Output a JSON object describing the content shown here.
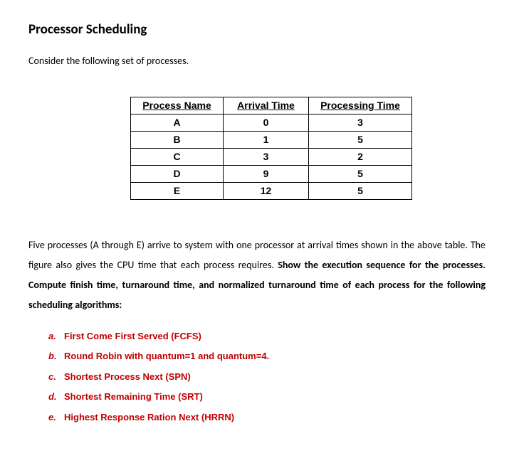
{
  "title": "Processor Scheduling",
  "intro": "Consider the following set of processes.",
  "table": {
    "headers": [
      "Process Name",
      "Arrival Time",
      "Processing Time"
    ],
    "rows": [
      [
        "A",
        "0",
        "3"
      ],
      [
        "B",
        "1",
        "5"
      ],
      [
        "C",
        "3",
        "2"
      ],
      [
        "D",
        "9",
        "5"
      ],
      [
        "E",
        "12",
        "5"
      ]
    ]
  },
  "body": {
    "part1": "Five processes (A through E) arrive to system with one processor at arrival times shown in the above table. The figure also gives the CPU time that each process requires. ",
    "bold": "Show the execution sequence for the processes. Compute finish time, turnaround time, and normalized turnaround time of each process for the following scheduling algorithms:"
  },
  "algorithms": [
    {
      "marker": "a.",
      "text": "First Come First Served (FCFS)"
    },
    {
      "marker": "b.",
      "text": "Round Robin with quantum=1 and quantum=4."
    },
    {
      "marker": "c.",
      "text": "Shortest Process Next (SPN)"
    },
    {
      "marker": "d.",
      "text": "Shortest Remaining Time (SRT)"
    },
    {
      "marker": "e.",
      "text": "Highest Response Ration Next (HRRN)"
    }
  ]
}
